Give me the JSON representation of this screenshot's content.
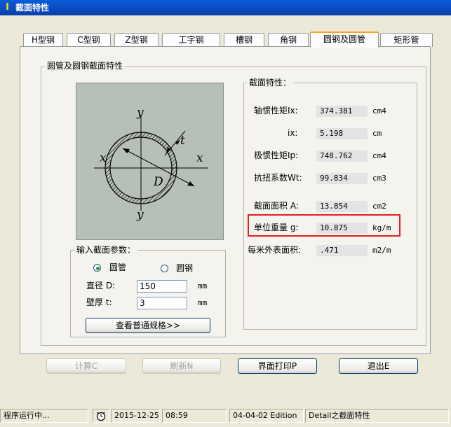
{
  "window": {
    "title": "截面特性"
  },
  "tabs": [
    {
      "label": "H型钢"
    },
    {
      "label": "C型钢"
    },
    {
      "label": "Z型钢"
    },
    {
      "label": "工字钢"
    },
    {
      "label": "槽钢"
    },
    {
      "label": "角钢"
    },
    {
      "label": "圆钢及圆管"
    },
    {
      "label": "矩形管"
    }
  ],
  "main_group": {
    "title": "圆管及圆钢截面特性"
  },
  "diagram": {
    "y_top": "y",
    "y_bottom": "y",
    "x_left": "x",
    "x_right": "x",
    "t": "t",
    "D": "D"
  },
  "props_group": {
    "title": "截面特性："
  },
  "props": [
    {
      "label": "轴惯性矩Ix:",
      "value": "374.381",
      "unit": "cm4"
    },
    {
      "label": "ix:",
      "value": "5.198",
      "unit": "cm"
    },
    {
      "label": "极惯性矩Ip:",
      "value": "748.762",
      "unit": "cm4"
    },
    {
      "label": "抗扭系数Wt:",
      "value": "99.834",
      "unit": "cm3"
    },
    {
      "label": "截面面积 A:",
      "value": "13.854",
      "unit": "cm2"
    },
    {
      "label": "单位重量 g:",
      "value": "10.875",
      "unit": "kg/m"
    },
    {
      "label": "每米外表面积:",
      "value": ".471",
      "unit": "m2/m"
    }
  ],
  "input_group": {
    "title": "输入截面参数：",
    "radio_pipe": "圆管",
    "radio_bar": "圆钢",
    "d_label": "直径 D:",
    "d_value": "150",
    "d_unit": "mm",
    "t_label": "壁厚 t:",
    "t_value": "3",
    "t_unit": "mm",
    "spec_button": "查看普通规格>>"
  },
  "buttons": {
    "calc": "计算C",
    "refresh": "刷新N",
    "print": "界面打印P",
    "exit": "退出E"
  },
  "status": {
    "state": "程序运行中...",
    "date": "2015-12-25",
    "time": "08:59",
    "edition": "04-04-02 Edition",
    "info": "Detail之截面特性"
  }
}
